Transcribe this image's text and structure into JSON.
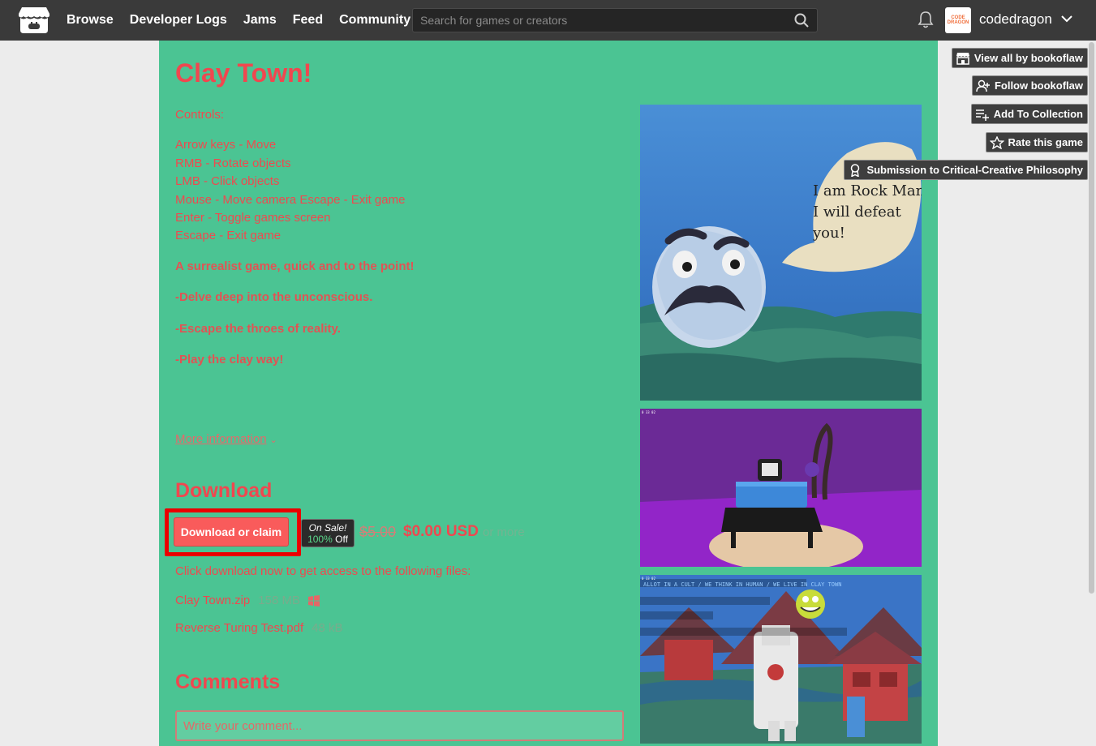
{
  "nav": {
    "logo_icon": "itchio-logo-icon",
    "links": [
      "Browse",
      "Developer Logs",
      "Jams",
      "Feed",
      "Community"
    ],
    "search_placeholder": "Search for games or creators",
    "avatar_text": "CODE DRAGON",
    "username": "codedragon"
  },
  "game": {
    "title": "Clay Town!",
    "controls_heading": "Controls:",
    "controls": [
      "Arrow keys - Move",
      "RMB - Rotate objects",
      "LMB - Click objects",
      "Mouse - Move camera Escape - Exit game",
      "Enter - Toggle games screen",
      "Escape - Exit game"
    ],
    "paragraphs": [
      "A surrealist game, quick and to the point!",
      "-Delve deep into the unconscious.",
      "-Escape the throes of reality.",
      "-Play the clay way!"
    ],
    "more_info": "More information"
  },
  "download": {
    "heading": "Download",
    "button": "Download or claim",
    "sale_label": "On Sale!",
    "sale_pct": "100%",
    "sale_off": "Off",
    "price_old": "$5.00",
    "price_new": "$0.00 USD",
    "price_more": "or more",
    "note": "Click download now to get access to the following files:",
    "files": [
      {
        "name": "Clay Town.zip",
        "size": "158 MB",
        "platform_icon": "windows-icon"
      },
      {
        "name": "Reverse Turing Test.pdf",
        "size": "48 kB"
      }
    ]
  },
  "comments": {
    "heading": "Comments",
    "placeholder": "Write your comment..."
  },
  "sidebar": {
    "view_all": "View all by bookoflaw",
    "follow": "Follow bookoflaw",
    "add_collection": "Add To Collection",
    "rate": "Rate this game",
    "submission": "Submission to Critical-Creative Philosophy"
  },
  "screenshots": {
    "speech_lines": [
      "I am Rock Man.",
      "I will defeat",
      "you!"
    ],
    "hud_text": "0 33 02",
    "sign_text": "ALLOT IN A CULT / WE THINK IN HUMAN / WE LIVE IN CLAY TOWN"
  },
  "colors": {
    "page_bg": "#4bc493",
    "text": "#ee4a4f",
    "button": "#f95b5b",
    "nav_bg": "#3a3a3a",
    "highlight": "#ea0000"
  }
}
